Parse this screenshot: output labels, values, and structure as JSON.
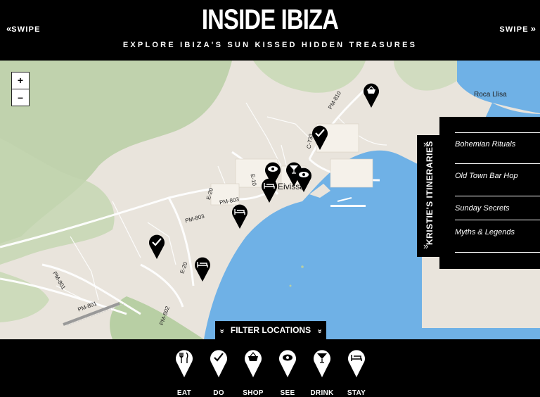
{
  "header": {
    "title": "INSIDE IBIZA",
    "tagline": "EXPLORE IBIZA'S SUN KISSED HIDDEN TREASURES",
    "swipe_left": "SWIPE",
    "swipe_right": "SWIPE"
  },
  "map": {
    "zoom_in": "+",
    "zoom_out": "–",
    "labels": {
      "city": "Eivissa",
      "roca": "Roca Llisa",
      "pm803": "PM-803",
      "pm803b": "PM-803",
      "e20": "E-20",
      "e20b": "E-20",
      "e10": "E-10",
      "c733": "C-733",
      "pm801": "PM-801",
      "pm802": "PM-802",
      "pm810": "PM-810"
    },
    "pins": [
      {
        "icon": "shop"
      },
      {
        "icon": "do"
      },
      {
        "icon": "see"
      },
      {
        "icon": "drink"
      },
      {
        "icon": "see"
      },
      {
        "icon": "stay"
      },
      {
        "icon": "stay"
      },
      {
        "icon": "do"
      },
      {
        "icon": "stay"
      }
    ]
  },
  "itineraries": {
    "tab_label": "KRISTIE'S ITINERARIES",
    "items": [
      "Bohemian Rituals",
      "Old Town Bar Hop",
      "Sunday Secrets",
      "Myths & Legends"
    ]
  },
  "filter": {
    "label": "FILTER LOCATIONS"
  },
  "categories": [
    {
      "label": "EAT",
      "icon": "fork-knife"
    },
    {
      "label": "DO",
      "icon": "check"
    },
    {
      "label": "SHOP",
      "icon": "basket"
    },
    {
      "label": "SEE",
      "icon": "eye"
    },
    {
      "label": "DRINK",
      "icon": "cocktail"
    },
    {
      "label": "STAY",
      "icon": "bed"
    }
  ],
  "colors": {
    "background": "#000000",
    "land": "#e9e4dc",
    "sea": "#6fb1e6",
    "green": "#b8cfa4",
    "pin": "#000000"
  }
}
